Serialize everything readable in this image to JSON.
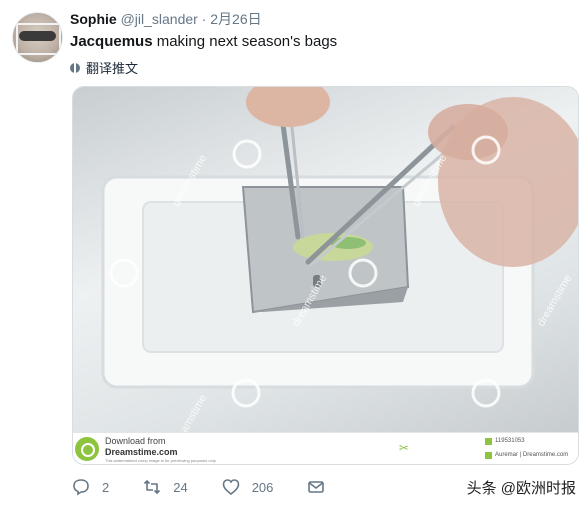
{
  "tweet": {
    "author_name": "Sophie",
    "handle": "@jil_slander",
    "separator": "·",
    "date": "2月26日",
    "text_brand": "Jacquemus",
    "text_rest": " making next season's bags",
    "translate_label": "翻译推文"
  },
  "media": {
    "stock_download": "Download from",
    "stock_site": "Dreamstime.com",
    "stock_notice": "This watermarked comp image is for previewing purposes only.",
    "stock_id": "119531053",
    "stock_credit": "Auremar | Dreamstime.com",
    "watermark_text": "dreamstime"
  },
  "actions": {
    "reply_count": "2",
    "retweet_count": "24",
    "like_count": "206"
  },
  "source_watermark": "头条 @欧洲时报"
}
